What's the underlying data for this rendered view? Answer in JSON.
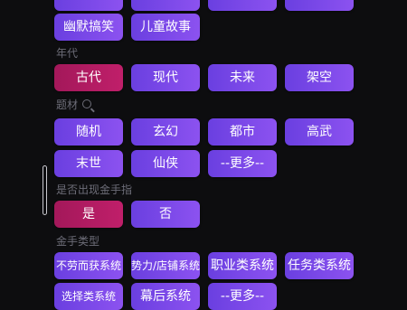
{
  "colors": {
    "background": "#0d0d0f",
    "button": "#7a48e8",
    "selected": "#b31c62",
    "label": "#6d6d78"
  },
  "top_row": [
    {
      "label": ""
    },
    {
      "label": ""
    },
    {
      "label": ""
    },
    {
      "label": ""
    }
  ],
  "row_humor": [
    {
      "label": "幽默搞笑"
    },
    {
      "label": "儿童故事"
    }
  ],
  "era": {
    "label": "年代",
    "options": [
      {
        "label": "古代",
        "selected": true
      },
      {
        "label": "现代"
      },
      {
        "label": "未来"
      },
      {
        "label": "架空"
      }
    ]
  },
  "theme": {
    "label": "题材",
    "search_icon": "search-icon",
    "options": [
      {
        "label": "随机"
      },
      {
        "label": "玄幻"
      },
      {
        "label": "都市"
      },
      {
        "label": "高武"
      },
      {
        "label": "末世"
      },
      {
        "label": "仙侠"
      },
      {
        "label": "--更多--"
      }
    ]
  },
  "golden_finger": {
    "label": "是否出现金手指",
    "options": [
      {
        "label": "是",
        "selected": true
      },
      {
        "label": "否"
      }
    ]
  },
  "finger_type": {
    "label": "金手类型",
    "options": [
      {
        "label": "不劳而获系统"
      },
      {
        "label": "势力/店铺系统"
      },
      {
        "label": "职业类系统"
      },
      {
        "label": "任务类系统"
      },
      {
        "label": "选择类系统"
      },
      {
        "label": "幕后系统"
      },
      {
        "label": "--更多--"
      }
    ]
  }
}
